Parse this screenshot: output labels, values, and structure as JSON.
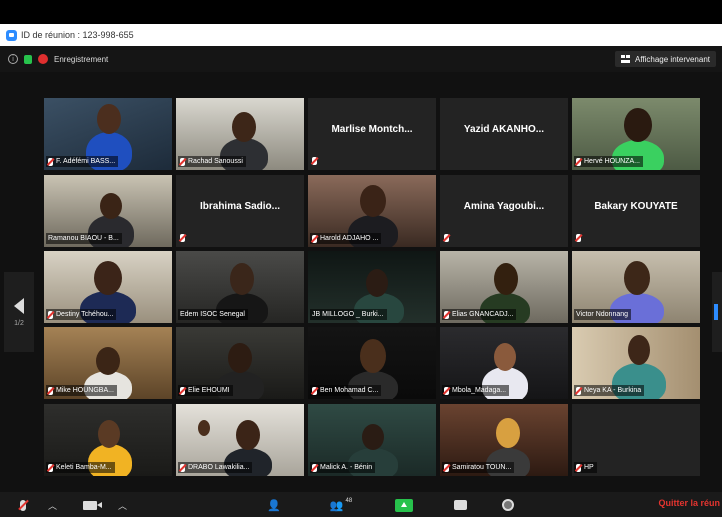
{
  "window": {
    "title": "ID de réunion : 123-998-655"
  },
  "status": {
    "recording_label": "Enregistrement",
    "speaker_view_label": "Affichage intervenant"
  },
  "pager": {
    "page": "1/2"
  },
  "tiles": [
    {
      "name": "F. Adéfémi BASS...",
      "muted": true
    },
    {
      "name": "Rachad Sanoussi",
      "muted": true
    },
    {
      "name": "Marlise Montch...",
      "muted": true
    },
    {
      "name": "Yazid AKANHO...",
      "muted": false
    },
    {
      "name": "Hervé HOUNZA...",
      "muted": true
    },
    {
      "name": "Ramanou BIAOU - B...",
      "muted": false
    },
    {
      "name": "Ibrahima Sadio...",
      "muted": true
    },
    {
      "name": "Harold ADJAHO ...",
      "muted": true
    },
    {
      "name": "Amina Yagoubi...",
      "muted": true
    },
    {
      "name": "Bakary KOUYATE",
      "muted": true
    },
    {
      "name": "Destiny Tchéhou...",
      "muted": true
    },
    {
      "name": "Edem ISOC Senegal",
      "muted": false
    },
    {
      "name": "JB MILLOGO _ Burki...",
      "muted": false
    },
    {
      "name": "Elias GNANCADJ...",
      "muted": true
    },
    {
      "name": "Victor Ndonnang",
      "muted": false
    },
    {
      "name": "Mike HOUNGBA...",
      "muted": true
    },
    {
      "name": "Elie EHOUMI",
      "muted": true
    },
    {
      "name": "Ben Mohamad C...",
      "muted": true
    },
    {
      "name": "Mbola_Madaga...",
      "muted": true
    },
    {
      "name": "Neya KA - Burkina",
      "muted": true
    },
    {
      "name": "Keleti Bamba-M...",
      "muted": true
    },
    {
      "name": "DRABO Lawakilia...",
      "muted": true
    },
    {
      "name": "Malick A. - Bénin",
      "muted": true
    },
    {
      "name": "Samiratou TOUN...",
      "muted": true
    },
    {
      "name": "HP",
      "muted": true
    }
  ],
  "toolbar": {
    "participants_count": "48",
    "leave_label": "Quitter la réun"
  },
  "colors": {
    "accent": "#2d8cff",
    "active_speaker": "#b5c633",
    "muted": "#e3342f",
    "share": "#27c24c"
  }
}
